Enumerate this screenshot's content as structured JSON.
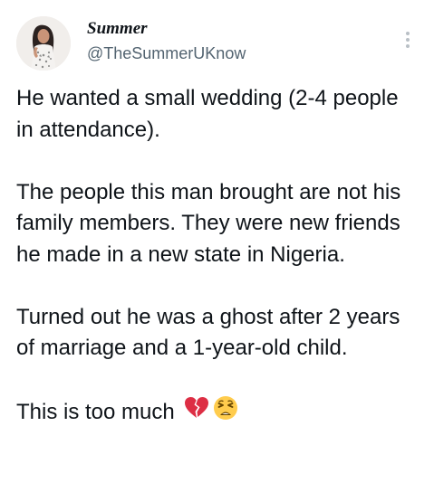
{
  "tweet": {
    "display_name": "Summer",
    "handle": "@TheSummerUKnow",
    "paragraphs": [
      "He wanted a small wedding (2-4 people in attendance).",
      "The people this man brought are not his family members. They were new friends he made in a new state in Nigeria.",
      "Turned out he was a ghost after 2 years of marriage and a 1-year-old child."
    ],
    "last_line": "This is too much",
    "emojis": [
      "broken-heart-icon",
      "weary-face-icon"
    ]
  },
  "colors": {
    "text": "#0f1419",
    "secondary": "#536471",
    "heart": "#e0245e",
    "face": "#ffcc4d"
  }
}
